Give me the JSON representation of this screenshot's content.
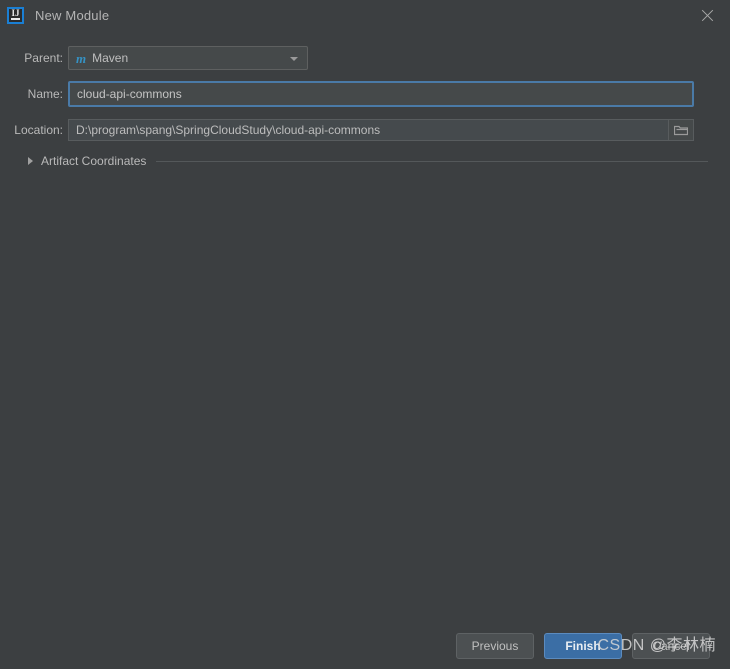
{
  "window": {
    "title": "New Module",
    "app_icon": "intellij-idea-icon",
    "close_icon": "close-icon"
  },
  "form": {
    "parent": {
      "label": "Parent:",
      "icon": "maven-icon",
      "icon_glyph": "m",
      "value": "Maven",
      "dropdown_icon": "chevron-down-icon"
    },
    "name": {
      "label": "Name:",
      "value": "cloud-api-commons",
      "placeholder": ""
    },
    "location": {
      "label": "Location:",
      "value": "D:\\program\\spang\\SpringCloudStudy\\cloud-api-commons",
      "placeholder": "",
      "browse_icon": "folder-icon"
    }
  },
  "artifact_section": {
    "label": "Artifact Coordinates",
    "expander_icon": "triangle-right-icon",
    "expanded": false
  },
  "footer": {
    "previous_label": "Previous",
    "finish_label": "Finish",
    "cancel_label": "Cancel"
  },
  "watermark": {
    "text": "CSDN @李林楠"
  },
  "colors": {
    "background": "#3c3f41",
    "field_background": "#45494a",
    "focus_border": "#4a7aa7",
    "primary_button": "#3b6ea5",
    "accent_blue": "#3592c4",
    "text": "#bbbbbb"
  }
}
